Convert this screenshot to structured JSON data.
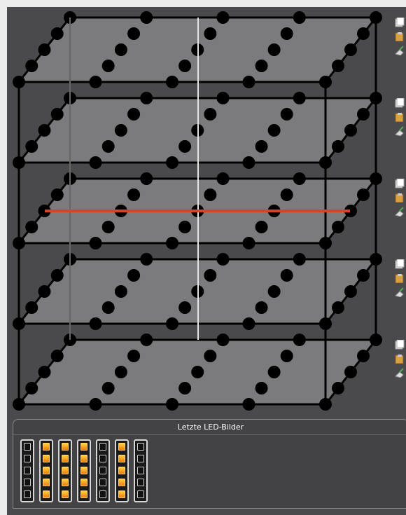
{
  "app": {
    "background": "#4a4a4c"
  },
  "cube": {
    "layers": 5,
    "leds_per_edge": 5,
    "rows_per_layer": 5,
    "layer_color": "#7b7b7d",
    "led_color": "#000000",
    "highlight_color": "#d94030",
    "highlighted_layer": 3
  },
  "layer_tools": [
    {
      "layer": 1,
      "icons": [
        "copy-icon",
        "paste-icon",
        "clear-icon"
      ]
    },
    {
      "layer": 2,
      "icons": [
        "copy-icon",
        "paste-icon",
        "clear-icon"
      ]
    },
    {
      "layer": 3,
      "icons": [
        "copy-icon",
        "paste-icon",
        "clear-icon"
      ]
    },
    {
      "layer": 4,
      "icons": [
        "copy-icon",
        "paste-icon",
        "clear-icon"
      ]
    },
    {
      "layer": 5,
      "icons": [
        "copy-icon",
        "paste-icon",
        "clear-icon"
      ]
    }
  ],
  "history": {
    "title": "Letzte LED-Bilder",
    "frames": [
      [
        0,
        0,
        0,
        0,
        0
      ],
      [
        1,
        1,
        1,
        1,
        1
      ],
      [
        1,
        1,
        1,
        1,
        1
      ],
      [
        1,
        1,
        1,
        1,
        1
      ],
      [
        0,
        0,
        0,
        0,
        0
      ],
      [
        1,
        1,
        1,
        1,
        1
      ],
      [
        0,
        0,
        0,
        0,
        0
      ]
    ]
  }
}
